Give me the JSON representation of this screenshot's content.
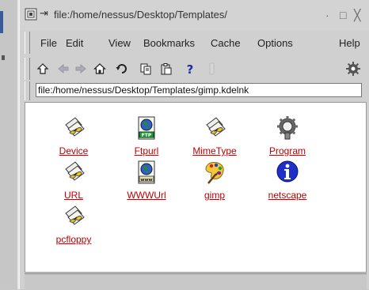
{
  "window": {
    "title": "file:/home/nessus/Desktop/Templates/",
    "buttons": {
      "minimize": "·",
      "maximize": "□",
      "close": "╳"
    }
  },
  "menubar": {
    "items": [
      {
        "label": "File"
      },
      {
        "label": "Edit"
      },
      {
        "label": "View"
      },
      {
        "label": "Bookmarks"
      },
      {
        "label": "Cache"
      },
      {
        "label": "Options"
      },
      {
        "label": "Help"
      }
    ]
  },
  "toolbar": {
    "buttons": [
      "up-icon",
      "back-icon",
      "forward-icon",
      "home-icon",
      "reload-icon",
      "copy-icon",
      "paste-icon",
      "help-icon",
      "stop-icon",
      "gear-icon"
    ]
  },
  "location": {
    "value": "file:/home/nessus/Desktop/Templates/gimp.kdelnk"
  },
  "icons": [
    {
      "label": "Device",
      "icon": "device-link-icon"
    },
    {
      "label": "Ftpurl",
      "icon": "ftp-url-icon"
    },
    {
      "label": "MimeType",
      "icon": "mimetype-link-icon"
    },
    {
      "label": "Program",
      "icon": "program-gear-icon"
    },
    {
      "label": "URL",
      "icon": "url-link-icon"
    },
    {
      "label": "WWWUrl",
      "icon": "www-url-icon"
    },
    {
      "label": "gimp",
      "icon": "gimp-palette-icon"
    },
    {
      "label": "netscape",
      "icon": "info-icon"
    },
    {
      "label": "pcfloppy",
      "icon": "floppy-link-icon"
    }
  ],
  "colors": {
    "link": "#c00000",
    "background": "#ffffff",
    "chrome": "#d0d0d0"
  }
}
